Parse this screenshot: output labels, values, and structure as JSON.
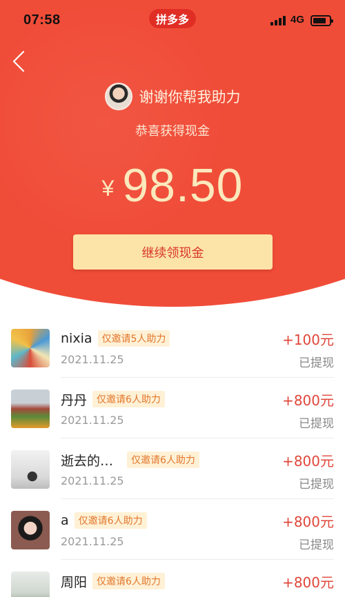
{
  "status_bar": {
    "time": "07:58",
    "app_badge": "拼多多",
    "network": "4G"
  },
  "header": {
    "back_icon": "chevron-left-icon",
    "inviter_text": "谢谢你帮我助力",
    "congrats_text": "恭喜获得现金",
    "currency": "¥",
    "amount": "98.50",
    "continue_button": "继续领现金"
  },
  "colors": {
    "hero_red": "#f04d39",
    "button_gold": "#fce3a8",
    "reward_red": "#e0463a",
    "tag_orange": "#e2772d"
  },
  "list": {
    "items": [
      {
        "name": "nixia",
        "tag": "仅邀请5人助力",
        "date": "2021.11.25",
        "reward": "+100元",
        "status": "已提现"
      },
      {
        "name": "丹丹",
        "tag": "仅邀请6人助力",
        "date": "2021.11.25",
        "reward": "+800元",
        "status": "已提现"
      },
      {
        "name": "逝去的…",
        "tag": "仅邀请6人助力",
        "date": "2021.11.25",
        "reward": "+800元",
        "status": "已提现"
      },
      {
        "name": "a",
        "tag": "仅邀请6人助力",
        "date": "2021.11.25",
        "reward": "+800元",
        "status": "已提现"
      },
      {
        "name": "周阳",
        "tag": "仅邀请6人助力",
        "date": "",
        "reward": "+800元",
        "status": ""
      }
    ]
  }
}
